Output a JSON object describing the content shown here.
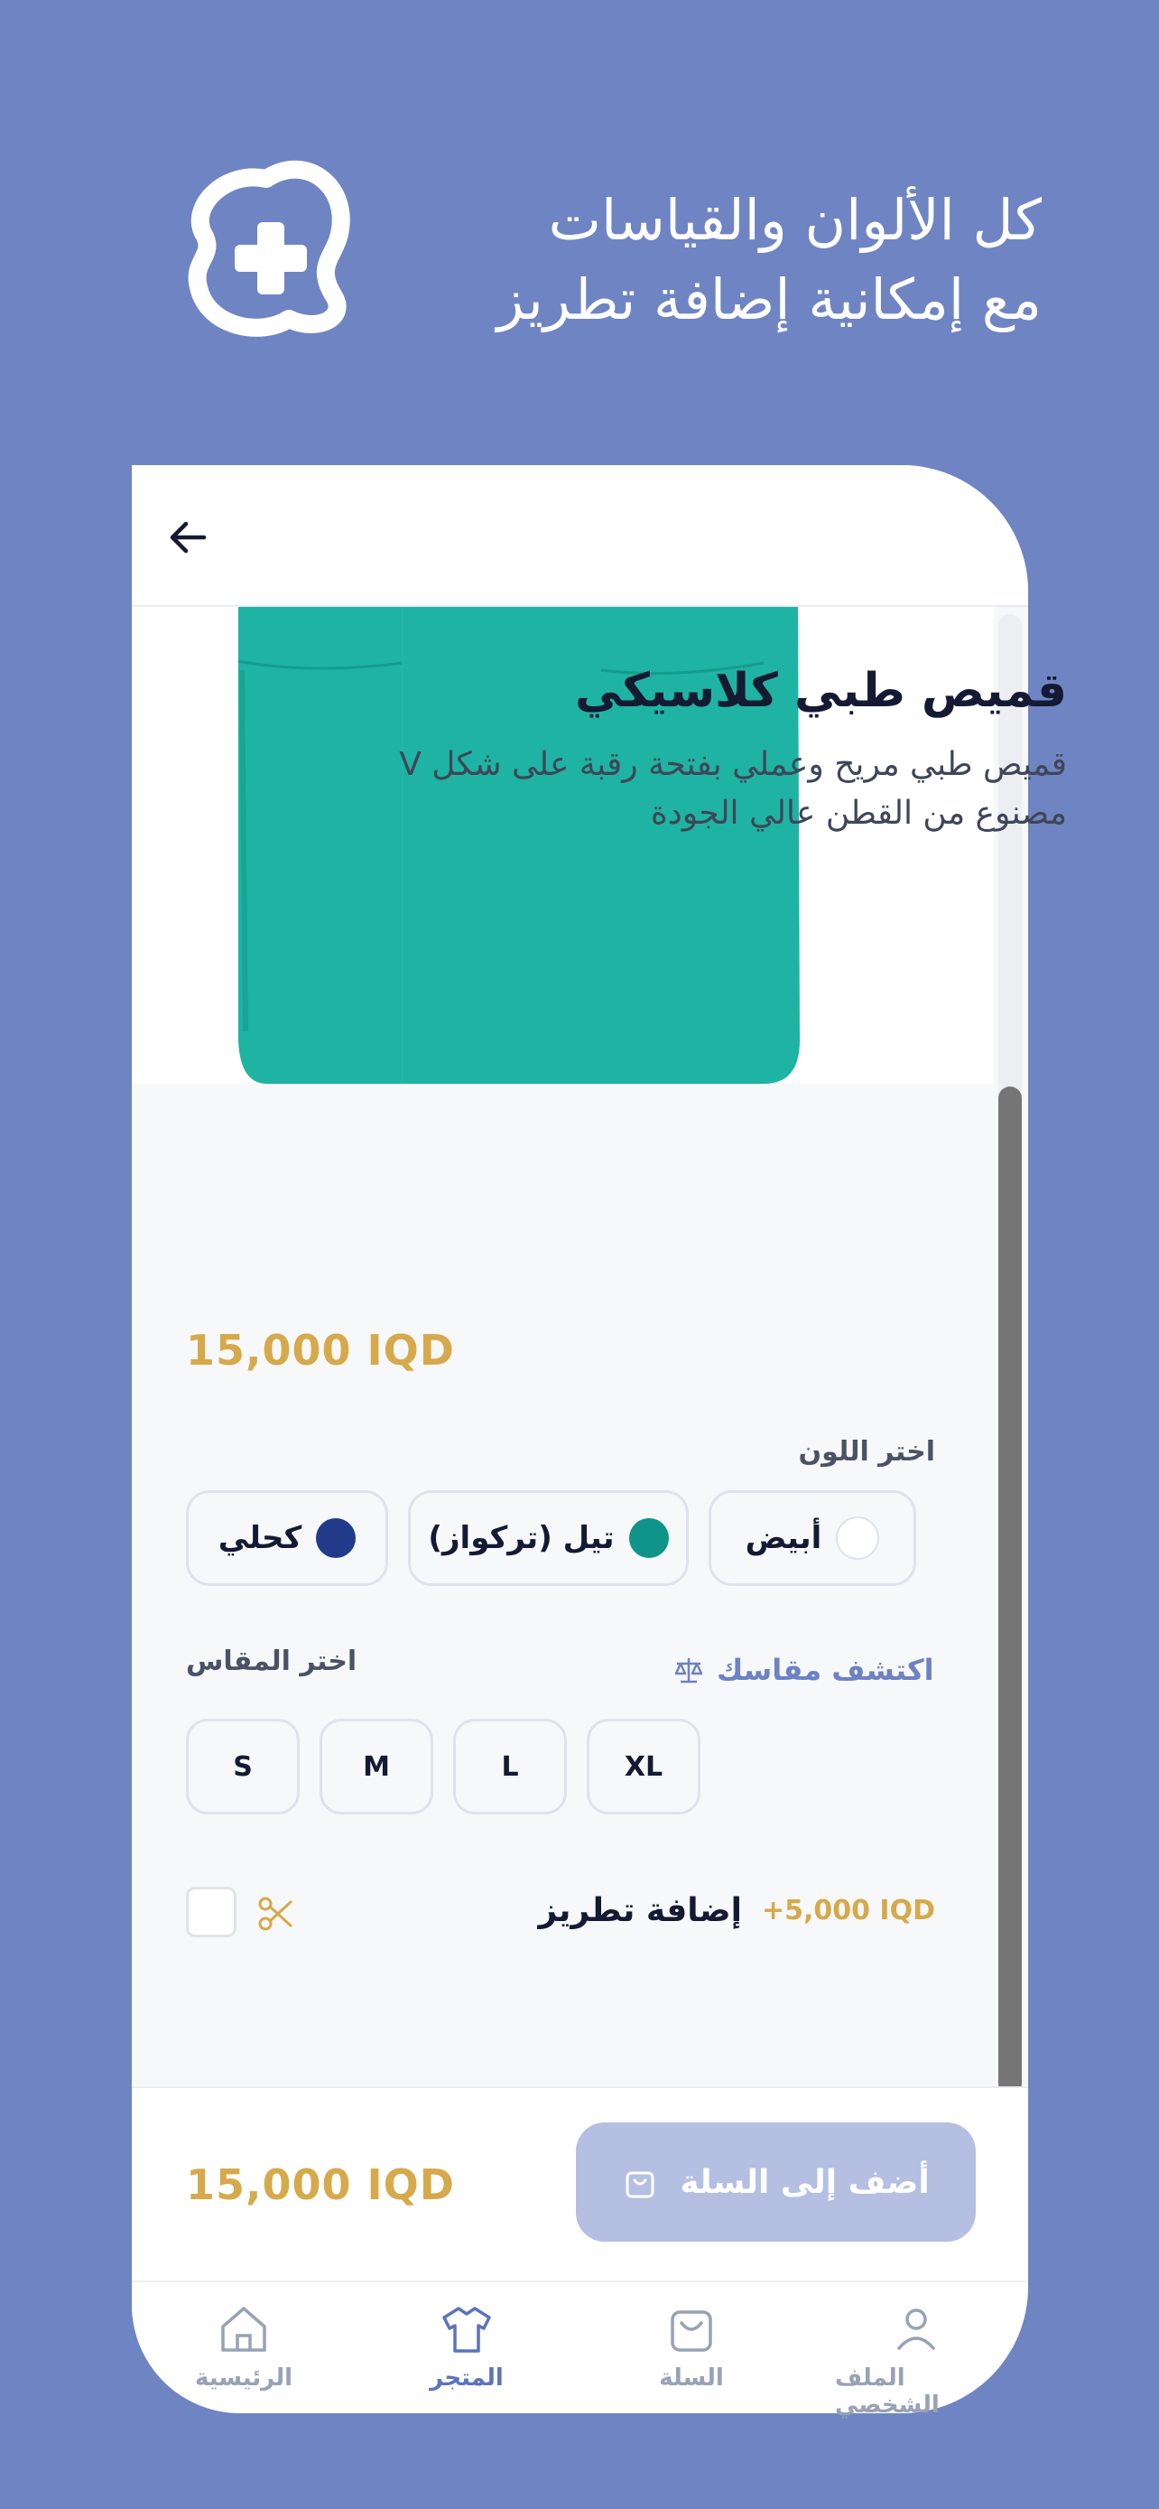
{
  "promo": {
    "headline_line1": "كل الألوان والقياسات",
    "headline_line2": "مع إمكانية إضافة تطريز",
    "logo_icon": "medical-plus-badge-icon"
  },
  "product": {
    "title": "قميص طبي كلاسيكي",
    "description": "قميص طبي مريح وعملي بفتحة رقبة على شكل V مصنوع من القطن عالي الجودة",
    "price": "15,000 IQD",
    "image_color": "#1fb3a3"
  },
  "color_section": {
    "label": "اختر اللون",
    "options": [
      {
        "label": "أبيض",
        "color": "#ffffff"
      },
      {
        "label": "تيل (تركواز)",
        "color": "#0e9488"
      },
      {
        "label": "كحلي",
        "color": "#213a8a"
      }
    ]
  },
  "size_section": {
    "label": "اختر المقاس",
    "guide_label": "اكتشف مقاسك",
    "options": [
      "XL",
      "L",
      "M",
      "S"
    ]
  },
  "embroidery": {
    "label": "إضافة تطريز",
    "price": "+5,000 IQD"
  },
  "footer": {
    "total": "15,000 IQD",
    "add_to_cart": "أضف إلى السلة"
  },
  "nav": {
    "items": [
      {
        "label": "الملف الشخصي",
        "icon": "user-icon",
        "active": false
      },
      {
        "label": "السلة",
        "icon": "bag-icon",
        "active": false
      },
      {
        "label": "المتجر",
        "icon": "shirt-icon",
        "active": true
      },
      {
        "label": "الرئيسية",
        "icon": "home-icon",
        "active": false
      }
    ]
  },
  "colors": {
    "background": "#6f84c3",
    "accent": "#5c73bd",
    "price": "#d6a94b"
  }
}
